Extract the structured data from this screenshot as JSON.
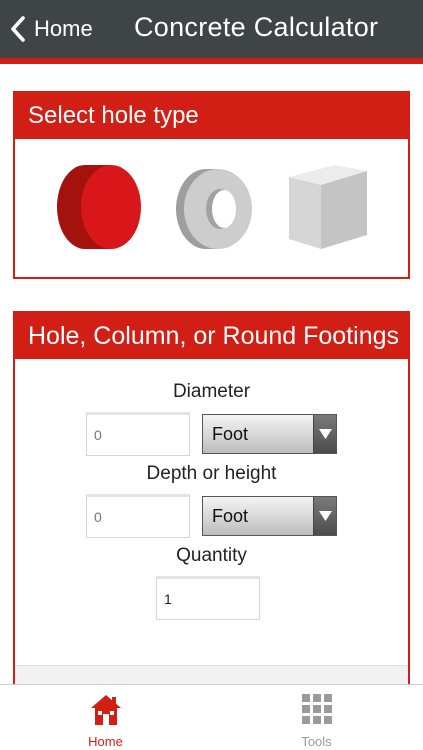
{
  "nav": {
    "back_label": "Home",
    "title": "Concrete Calculator"
  },
  "hole_type": {
    "title": "Select hole type",
    "options": [
      {
        "icon": "cylinder-icon",
        "selected": true
      },
      {
        "icon": "ring-icon",
        "selected": false
      },
      {
        "icon": "cube-icon",
        "selected": false
      }
    ]
  },
  "form": {
    "title": "Hole, Column, or Round Footings",
    "diameter": {
      "label": "Diameter",
      "placeholder": "0",
      "unit": "Foot"
    },
    "depth": {
      "label": "Depth or height",
      "placeholder": "0",
      "unit": "Foot"
    },
    "quantity": {
      "label": "Quantity",
      "value": "1"
    }
  },
  "tabs": [
    {
      "label": "Home",
      "icon": "house-icon",
      "active": true
    },
    {
      "label": "Tools",
      "icon": "grid-icon",
      "active": false
    }
  ],
  "colors": {
    "accent": "#d21f16",
    "navbar": "#3f4447",
    "shape_gray": "#c9c9c9"
  }
}
